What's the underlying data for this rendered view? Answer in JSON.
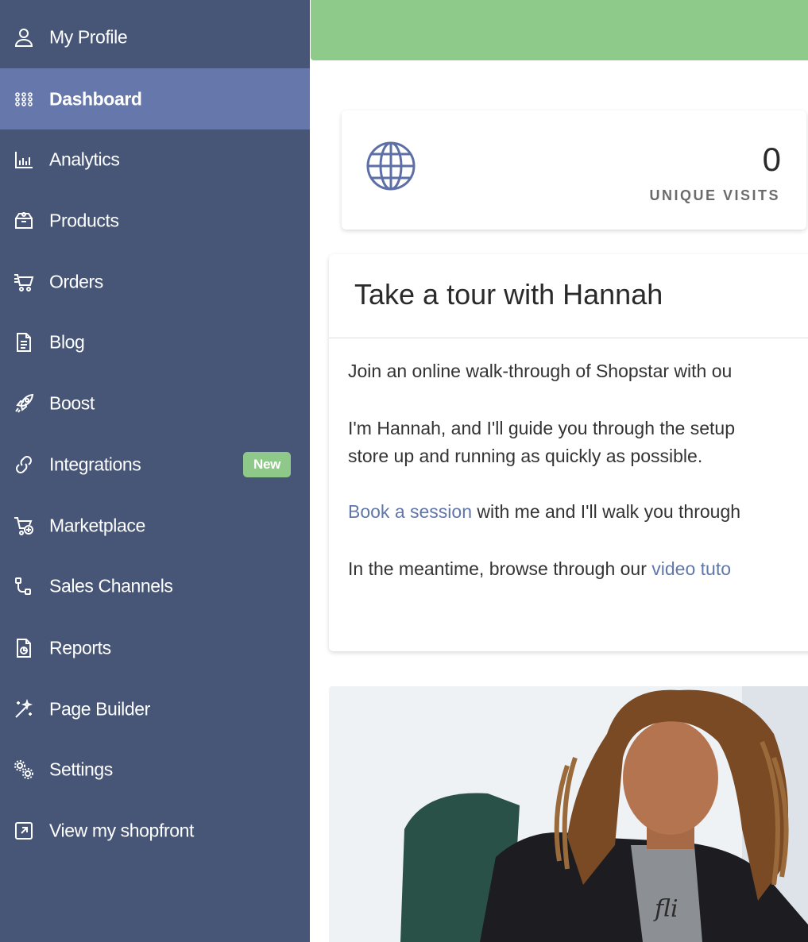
{
  "sidebar": {
    "items": [
      {
        "label": "My Profile",
        "icon": "user-icon"
      },
      {
        "label": "Dashboard",
        "icon": "grid-icon",
        "active": true
      },
      {
        "label": "Analytics",
        "icon": "bar-chart-icon"
      },
      {
        "label": "Products",
        "icon": "box-icon"
      },
      {
        "label": "Orders",
        "icon": "cart-icon"
      },
      {
        "label": "Blog",
        "icon": "document-icon"
      },
      {
        "label": "Boost",
        "icon": "rocket-icon"
      },
      {
        "label": "Integrations",
        "icon": "link-icon",
        "badge": "New"
      },
      {
        "label": "Marketplace",
        "icon": "cart-plus-icon"
      },
      {
        "label": "Sales Channels",
        "icon": "channels-icon"
      },
      {
        "label": "Reports",
        "icon": "report-icon"
      },
      {
        "label": "Page Builder",
        "icon": "magic-wand-icon"
      },
      {
        "label": "Settings",
        "icon": "gears-icon"
      },
      {
        "label": "View my shopfront",
        "icon": "external-link-icon"
      }
    ]
  },
  "stats": {
    "value": "0",
    "label": "UNIQUE VISITS",
    "icon": "globe-icon"
  },
  "tour": {
    "title": "Take a tour with Hannah",
    "p1": "Join an online walk-through of Shopstar with ou",
    "p2a": "I'm Hannah, and I'll guide you through the setup",
    "p2b": "store up and running as quickly as possible.",
    "p3_link": "Book a session",
    "p3_rest": " with me and I'll walk you through",
    "p4_text": "In the meantime, browse through our ",
    "p4_link": "video tuto"
  },
  "colors": {
    "sidebar_bg": "#475677",
    "sidebar_active": "#6577ab",
    "topbar": "#8ecb8b",
    "badge": "#8ec98a",
    "link": "#6177a9"
  }
}
